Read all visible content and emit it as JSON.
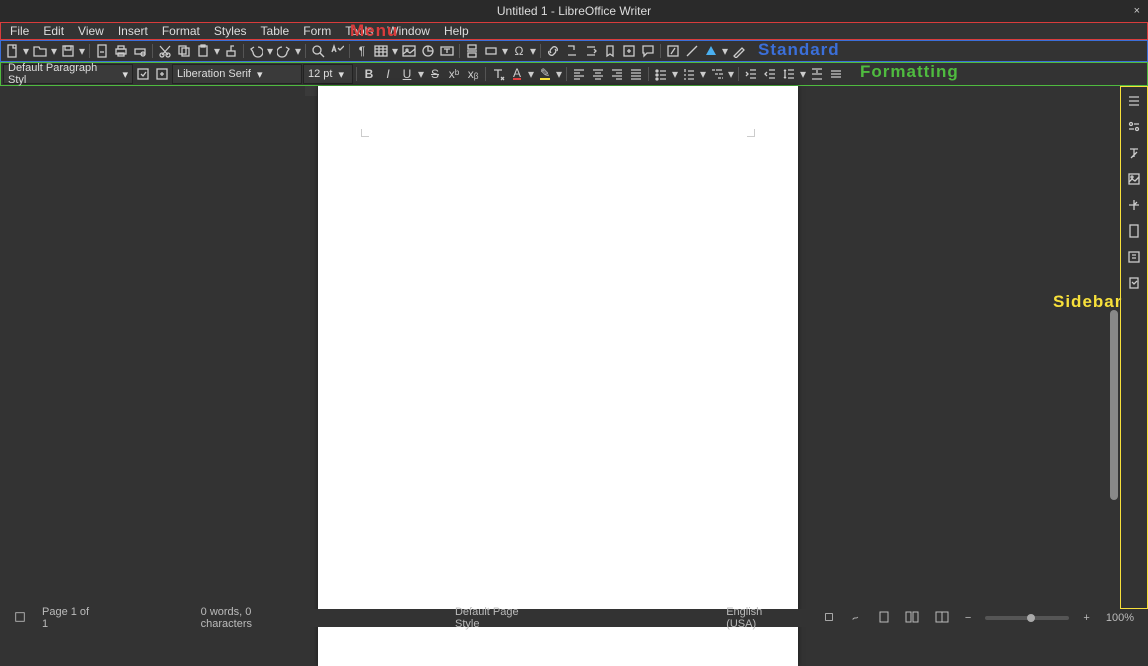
{
  "window": {
    "title": "Untitled 1 - LibreOffice Writer",
    "close": "×"
  },
  "menu": {
    "items": [
      "File",
      "Edit",
      "View",
      "Insert",
      "Format",
      "Styles",
      "Table",
      "Form",
      "Tools",
      "Window",
      "Help"
    ]
  },
  "annotations": {
    "menu": "Menu",
    "standard": "Standard",
    "formatting": "Formatting",
    "sidebar": "Sidebar"
  },
  "formatting": {
    "paragraph_style": "Default Paragraph Styl",
    "font_name": "Liberation Serif",
    "font_size": "12 pt",
    "bold": "B",
    "italic": "I",
    "underline": "U",
    "strike": "S",
    "super": "xᵇ",
    "sub": "xᵦ",
    "clear": "A",
    "fontcolor": "A",
    "highlight": "✎"
  },
  "status": {
    "page": "Page 1 of 1",
    "words": "0 words, 0 characters",
    "page_style": "Default Page Style",
    "language": "English (USA)",
    "insert": "",
    "zoom_pct": "100%",
    "zoom_minus": "−",
    "zoom_plus": "+"
  }
}
